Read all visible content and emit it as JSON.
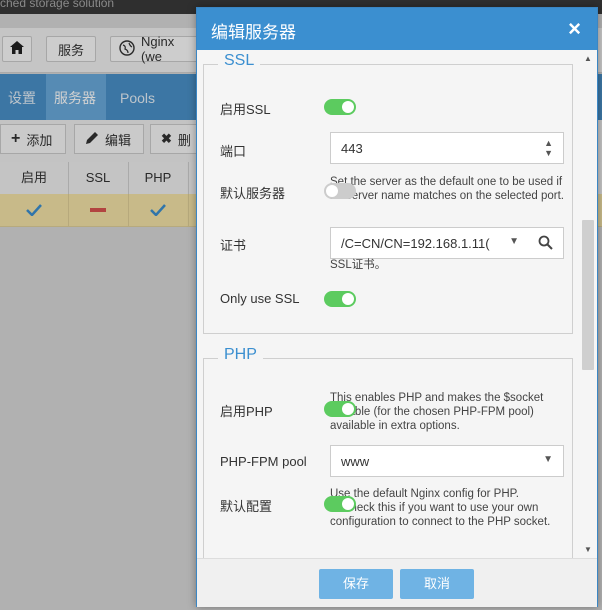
{
  "background": {
    "top_text": "ched storage solution",
    "toolbar": {
      "services": "服务",
      "nginx": "Nginx (we"
    },
    "tabs": [
      "设置",
      "服务器",
      "Pools"
    ],
    "actions": {
      "add": "添加",
      "edit": "编辑",
      "delete": "删"
    },
    "table_headers": [
      "启用",
      "SSL",
      "PHP"
    ]
  },
  "dialog": {
    "title": "编辑服务器",
    "ssl": {
      "legend": "SSL",
      "enable_label": "启用SSL",
      "enable_on": true,
      "port_label": "端口",
      "port_value": "443",
      "default_label": "默认服务器",
      "default_on": false,
      "default_help": "Set the server as the default one to be used if no server name matches on the selected port.",
      "cert_label": "证书",
      "cert_value": "/C=CN/CN=192.168.1.11(",
      "cert_help": "SSL证书。",
      "only_label": "Only use SSL",
      "only_on": true
    },
    "php": {
      "legend": "PHP",
      "enable_label": "启用PHP",
      "enable_on": true,
      "enable_help": "This enables PHP and makes the $socket variable (for the chosen PHP-FPM pool) available in extra options.",
      "pool_label": "PHP-FPM pool",
      "pool_value": "www",
      "default_label": "默认配置",
      "default_on": true,
      "default_help": "Use the default Nginx config for PHP. Uncheck this if you want to use your own configuration to connect to the PHP socket."
    },
    "buttons": {
      "save": "保存",
      "cancel": "取消"
    }
  },
  "colors": {
    "header": "#3b8fd0",
    "toggle_on": "#5ccb5f",
    "button": "#6fb3e4",
    "selected_row": "#f4e3a8"
  }
}
